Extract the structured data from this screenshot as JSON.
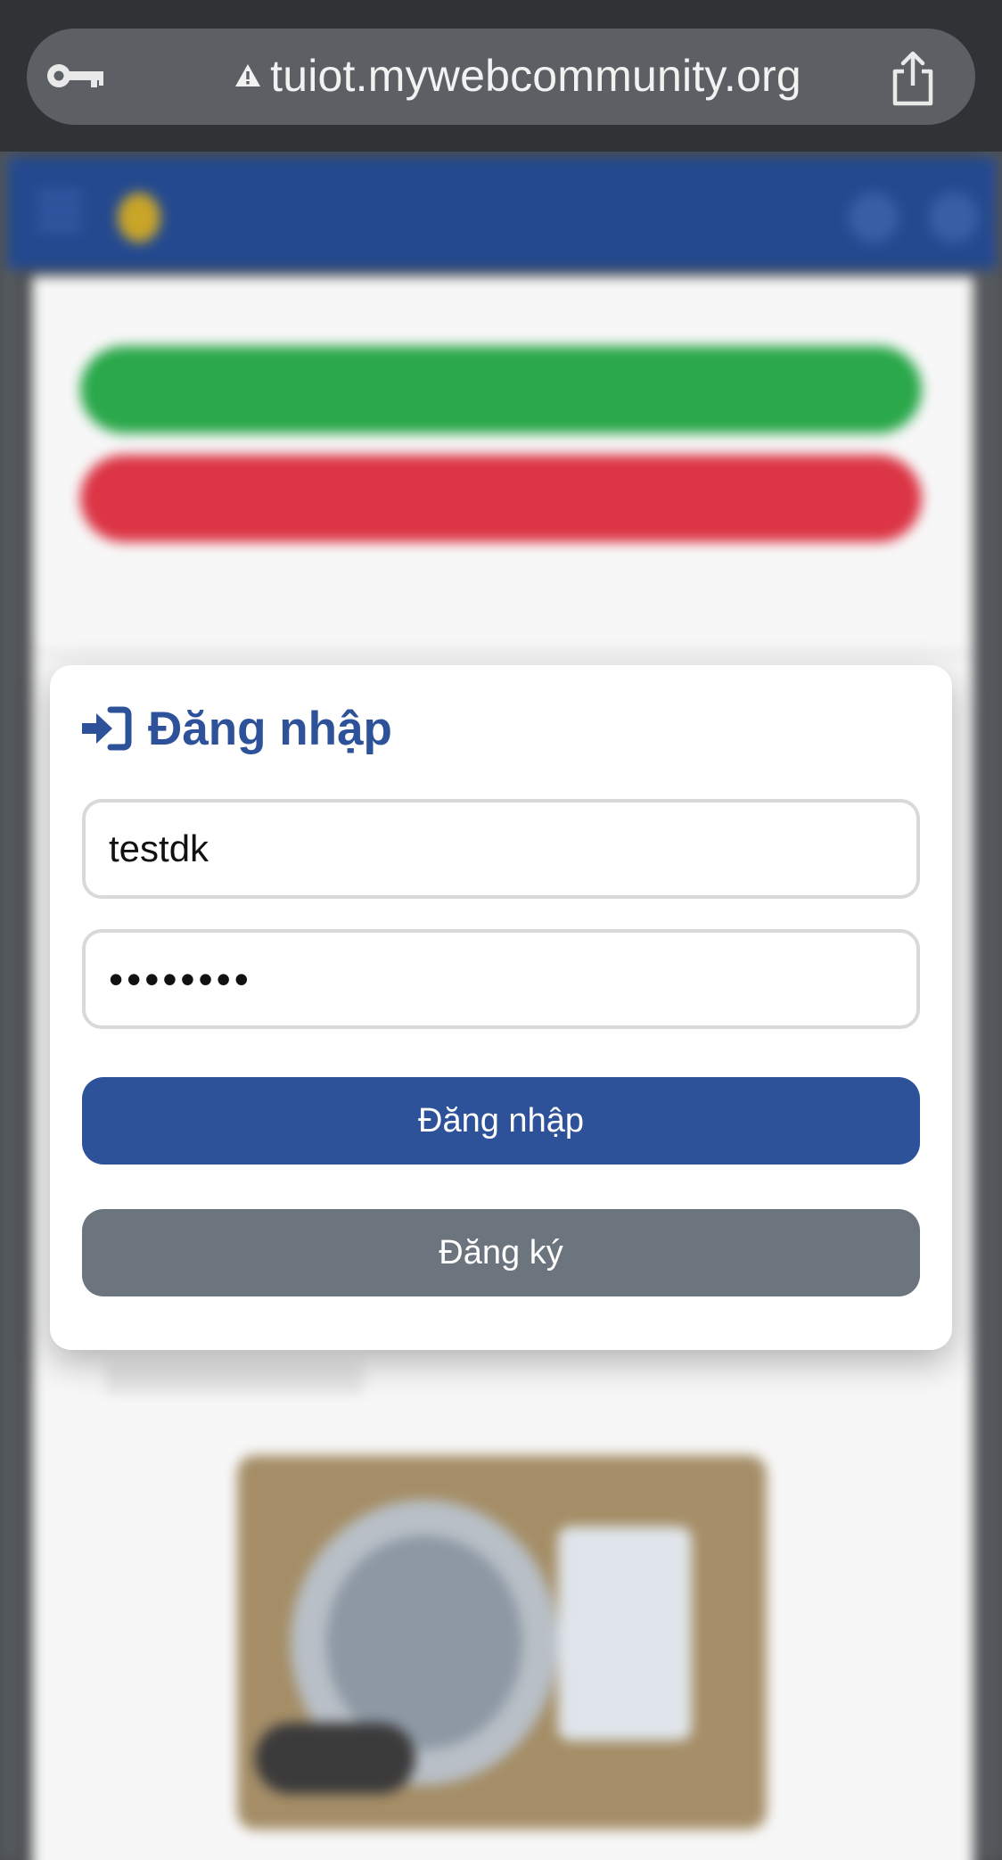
{
  "browser": {
    "url": "tuiot.mywebcommunity.org",
    "icons": [
      "key-icon",
      "warning-icon",
      "share-icon"
    ]
  },
  "background_page": {
    "header_icons": [
      "menu-icon",
      "bulb-icon",
      "settings-icon",
      "user-icon"
    ],
    "colors": {
      "header": "#24498f",
      "green_button": "#2aa84a",
      "red_button": "#dc3545"
    }
  },
  "login_modal": {
    "title": "Đăng nhập",
    "title_icon": "sign-in-icon",
    "username_value": "testdk",
    "password_value": "••••••••",
    "login_button": "Đăng nhập",
    "register_button": "Đăng ký",
    "colors": {
      "primary": "#2d5299",
      "secondary": "#6c757d"
    }
  }
}
